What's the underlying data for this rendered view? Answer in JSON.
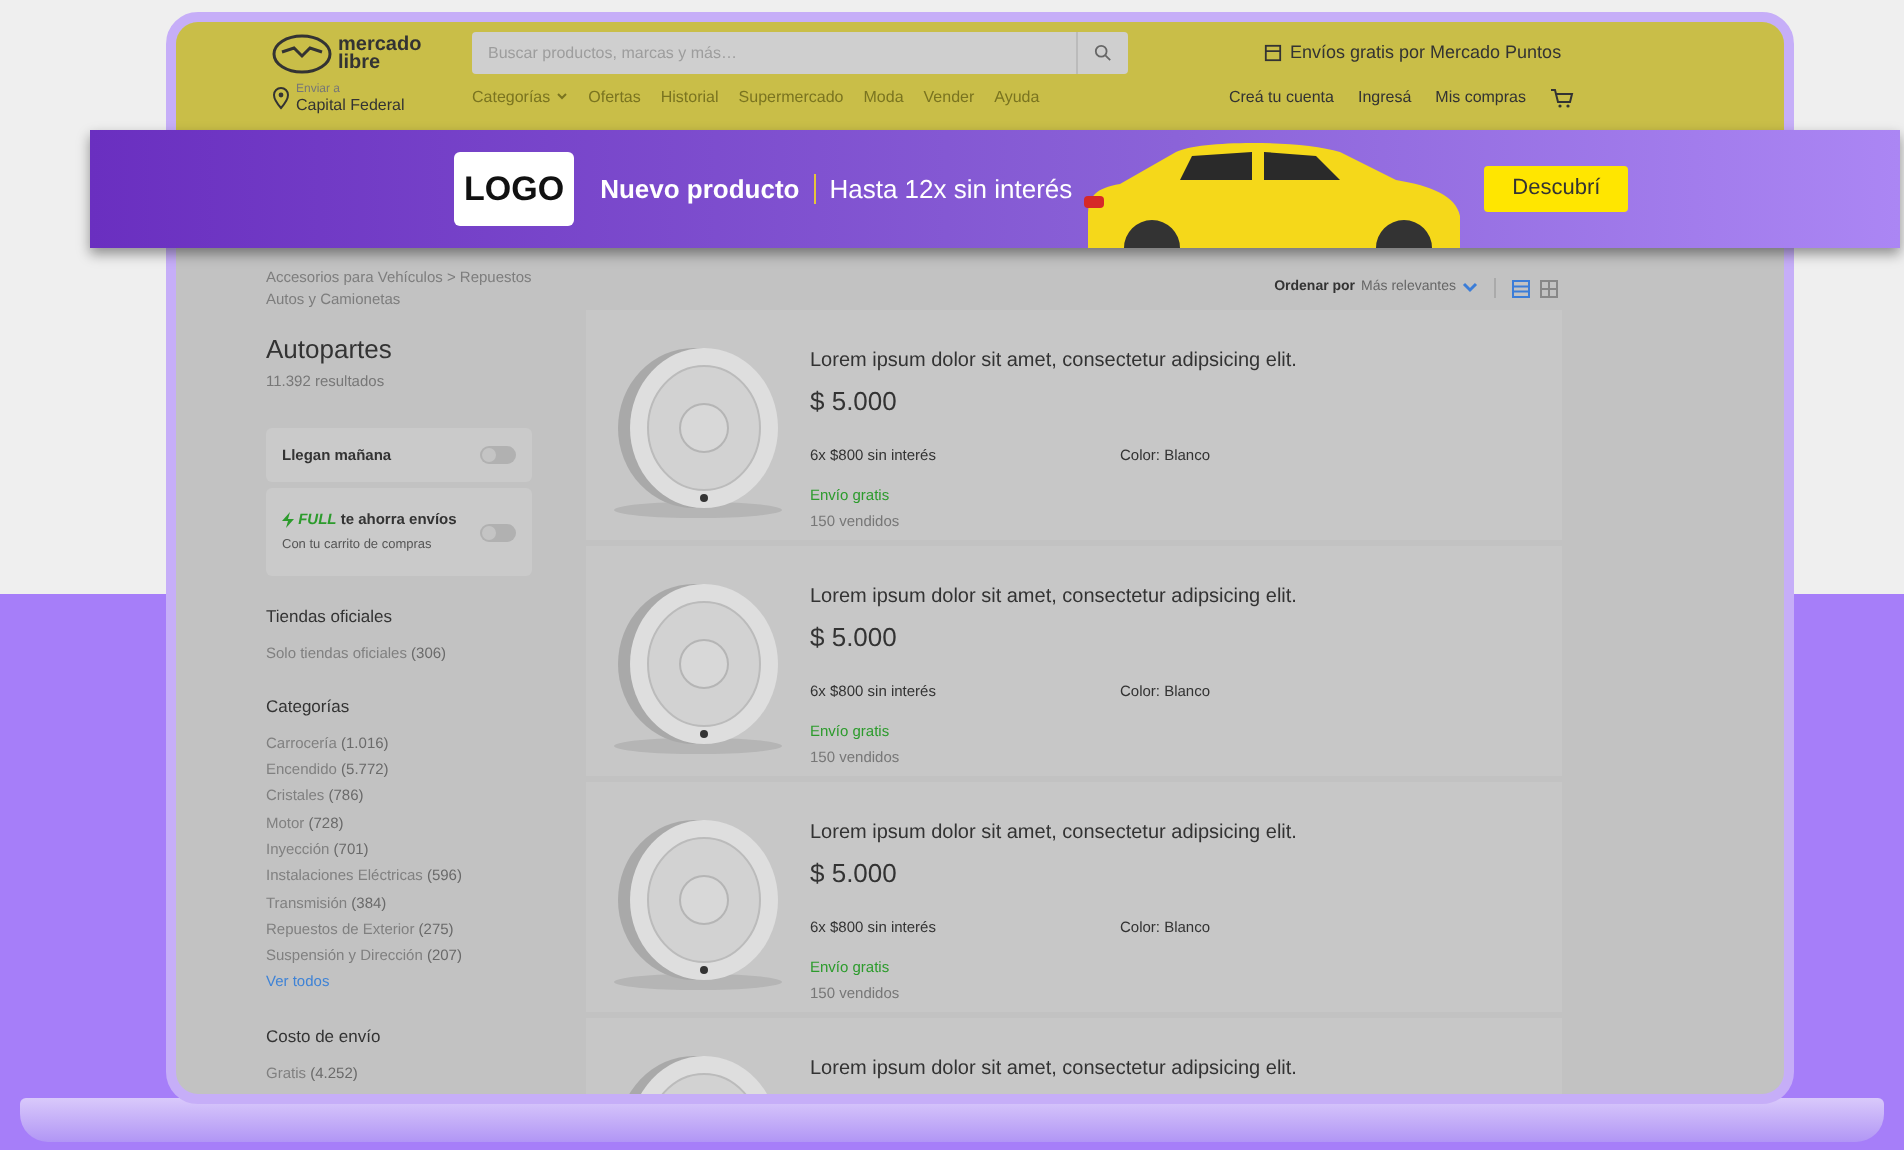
{
  "header": {
    "logo_text": "mercado libre",
    "search": {
      "placeholder": "Buscar productos, marcas y más…"
    },
    "promo": "Envíos gratis por Mercado Puntos",
    "location_label": "Enviar a",
    "location": "Capital Federal",
    "nav": [
      "Categorías",
      "Ofertas",
      "Historial",
      "Supermercado",
      "Moda",
      "Vender",
      "Ayuda"
    ],
    "account_links": [
      "Creá tu cuenta",
      "Ingresá",
      "Mis compras"
    ]
  },
  "banner": {
    "logo": "LOGO",
    "title": "Nuevo producto",
    "subtitle": "Hasta 12x sin interés",
    "button": "Descubrí"
  },
  "breadcrumb": "Accesorios para Vehículos > Repuestos Autos y Camionetas",
  "heading": "Autopartes",
  "results": "11.392 resultados",
  "filters": [
    {
      "kind": "toggle",
      "label": "Llegan mañana",
      "on": false
    },
    {
      "kind": "full",
      "badge": "FULL",
      "label": "te ahorra envíos",
      "sublabel": "Con tu carrito de compras",
      "on": false
    }
  ],
  "sections": [
    {
      "title": "Tiendas oficiales",
      "items": [
        {
          "label": "Solo tiendas oficiales",
          "count": "(306)"
        }
      ]
    },
    {
      "title": "Categorías",
      "items": [
        {
          "label": "Carrocería",
          "count": "(1.016)"
        },
        {
          "label": "Encendido",
          "count": "(5.772)"
        },
        {
          "label": "Cristales",
          "count": "(786)"
        },
        {
          "label": "Motor",
          "count": "(728)"
        },
        {
          "label": "Inyección",
          "count": "(701)"
        },
        {
          "label": "Instalaciones Eléctricas",
          "count": "(596)"
        },
        {
          "label": "Transmisión",
          "count": "(384)"
        },
        {
          "label": "Repuestos de Exterior",
          "count": "(275)"
        },
        {
          "label": "Suspensión y Dirección",
          "count": "(207)"
        }
      ],
      "more": "Ver todos"
    },
    {
      "title": "Costo de envío",
      "items": [
        {
          "label": "Gratis",
          "count": "(4.252)"
        }
      ]
    }
  ],
  "sort": {
    "label": "Ordenar por",
    "value": "Más relevantes"
  },
  "views": [
    {
      "kind": "list",
      "selected": true
    },
    {
      "kind": "grid",
      "selected": false
    }
  ],
  "products": [
    {
      "title": "Lorem ipsum dolor sit amet, consectetur adipsicing elit.",
      "price": "$ 5.000",
      "installments": "6x $800 sin interés",
      "color_label": "Color: Blanco",
      "shipping": "Envío gratis",
      "sold": "150 vendidos"
    },
    {
      "title": "Lorem ipsum dolor sit amet, consectetur adipsicing elit.",
      "price": "$ 5.000",
      "installments": "6x $800 sin interés",
      "color_label": "Color: Blanco",
      "shipping": "Envío gratis",
      "sold": "150 vendidos"
    },
    {
      "title": "Lorem ipsum dolor sit amet, consectetur adipsicing elit.",
      "price": "$ 5.000",
      "installments": "6x $800 sin interés",
      "color_label": "Color: Blanco",
      "shipping": "Envío gratis",
      "sold": "150 vendidos"
    },
    {
      "title": "Lorem ipsum dolor sit amet, consectetur adipsicing elit."
    }
  ]
}
